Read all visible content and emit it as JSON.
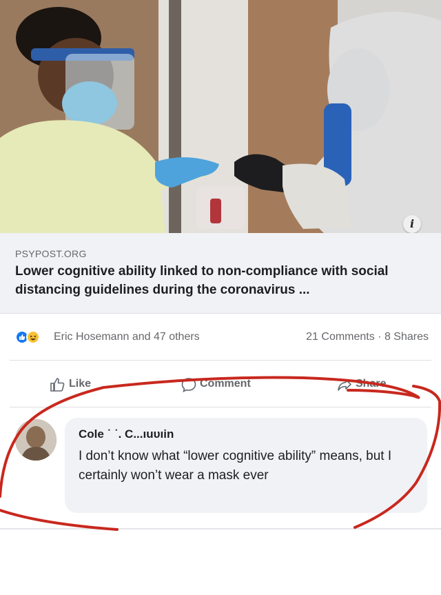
{
  "post": {
    "image_alt": "Medical workers in protective equipment",
    "info_icon": "info-icon",
    "link_source": "PSYPOST.ORG",
    "link_title": "Lower cognitive ability linked to non-compliance with social distancing guidelines during the coronavirus ..."
  },
  "stats": {
    "reaction_icons": [
      "like-reaction-icon",
      "haha-reaction-icon"
    ],
    "reactors": "Eric Hosemann and 47 others",
    "counts": "21 Comments · 8 Shares"
  },
  "actions": [
    {
      "label": "Like",
      "icon": "thumbs-up-icon"
    },
    {
      "label": "Comment",
      "icon": "comment-icon"
    },
    {
      "label": "Share",
      "icon": "share-arrow-icon"
    }
  ],
  "comment": {
    "author": "Cole ˙ ˙. C...ıuᴜıin",
    "text": "I don’t know what “lower cognitive ability” means, but I certainly won’t wear a mask ever"
  },
  "colors": {
    "annotation": "#c8281e",
    "like_blue": "#1877f2",
    "haha_yellow": "#f7c236"
  }
}
